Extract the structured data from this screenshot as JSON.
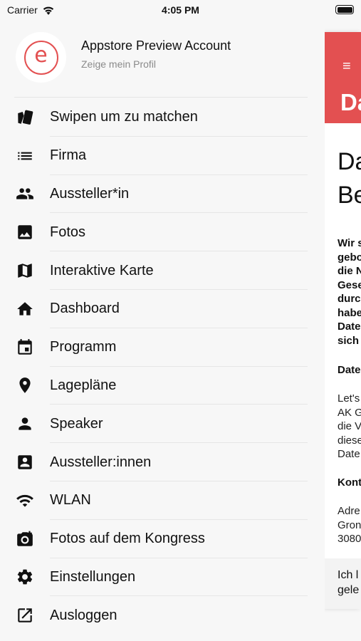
{
  "status": {
    "carrier": "Carrier",
    "time": "4:05 PM"
  },
  "profile": {
    "name": "Appstore Preview Account",
    "subtitle": "Zeige mein Profil",
    "avatar_letter": "e"
  },
  "menu": [
    {
      "label": "Swipen um zu matchen",
      "icon": "swipe-cards-icon"
    },
    {
      "label": "Firma",
      "icon": "list-icon"
    },
    {
      "label": "Aussteller*in",
      "icon": "people-icon"
    },
    {
      "label": "Fotos",
      "icon": "image-icon"
    },
    {
      "label": "Interaktive Karte",
      "icon": "map-icon"
    },
    {
      "label": "Dashboard",
      "icon": "home-icon"
    },
    {
      "label": "Programm",
      "icon": "calendar-icon"
    },
    {
      "label": "Lagepläne",
      "icon": "location-pin-icon"
    },
    {
      "label": "Speaker",
      "icon": "person-icon"
    },
    {
      "label": "Aussteller:innen",
      "icon": "contact-card-icon"
    },
    {
      "label": "WLAN",
      "icon": "wifi-icon"
    },
    {
      "label": "Fotos auf dem Kongress",
      "icon": "camera-icon"
    },
    {
      "label": "Einstellungen",
      "icon": "gear-icon"
    },
    {
      "label": "Ausloggen",
      "icon": "logout-icon"
    }
  ],
  "background_page": {
    "menu_glyph": "≡",
    "header_title": "Da",
    "heading_lines": [
      "Da",
      "Be"
    ],
    "bold_lines": [
      "Wir s",
      "gebo",
      "die N",
      "Gese",
      "durc",
      "habe",
      "Date",
      "sich"
    ],
    "section1": "Date",
    "para_lines": [
      "Let's",
      "AK G",
      "die V",
      "diese",
      "Date"
    ],
    "section2": "Kont",
    "address_lines": [
      "Adre",
      "Gron",
      "3080"
    ],
    "footer_lines": [
      "Ich l",
      "gele"
    ]
  },
  "colors": {
    "accent": "#e35051",
    "text": "#111111",
    "muted": "#8a8a8a",
    "drawer_bg": "#f7f7f7"
  }
}
